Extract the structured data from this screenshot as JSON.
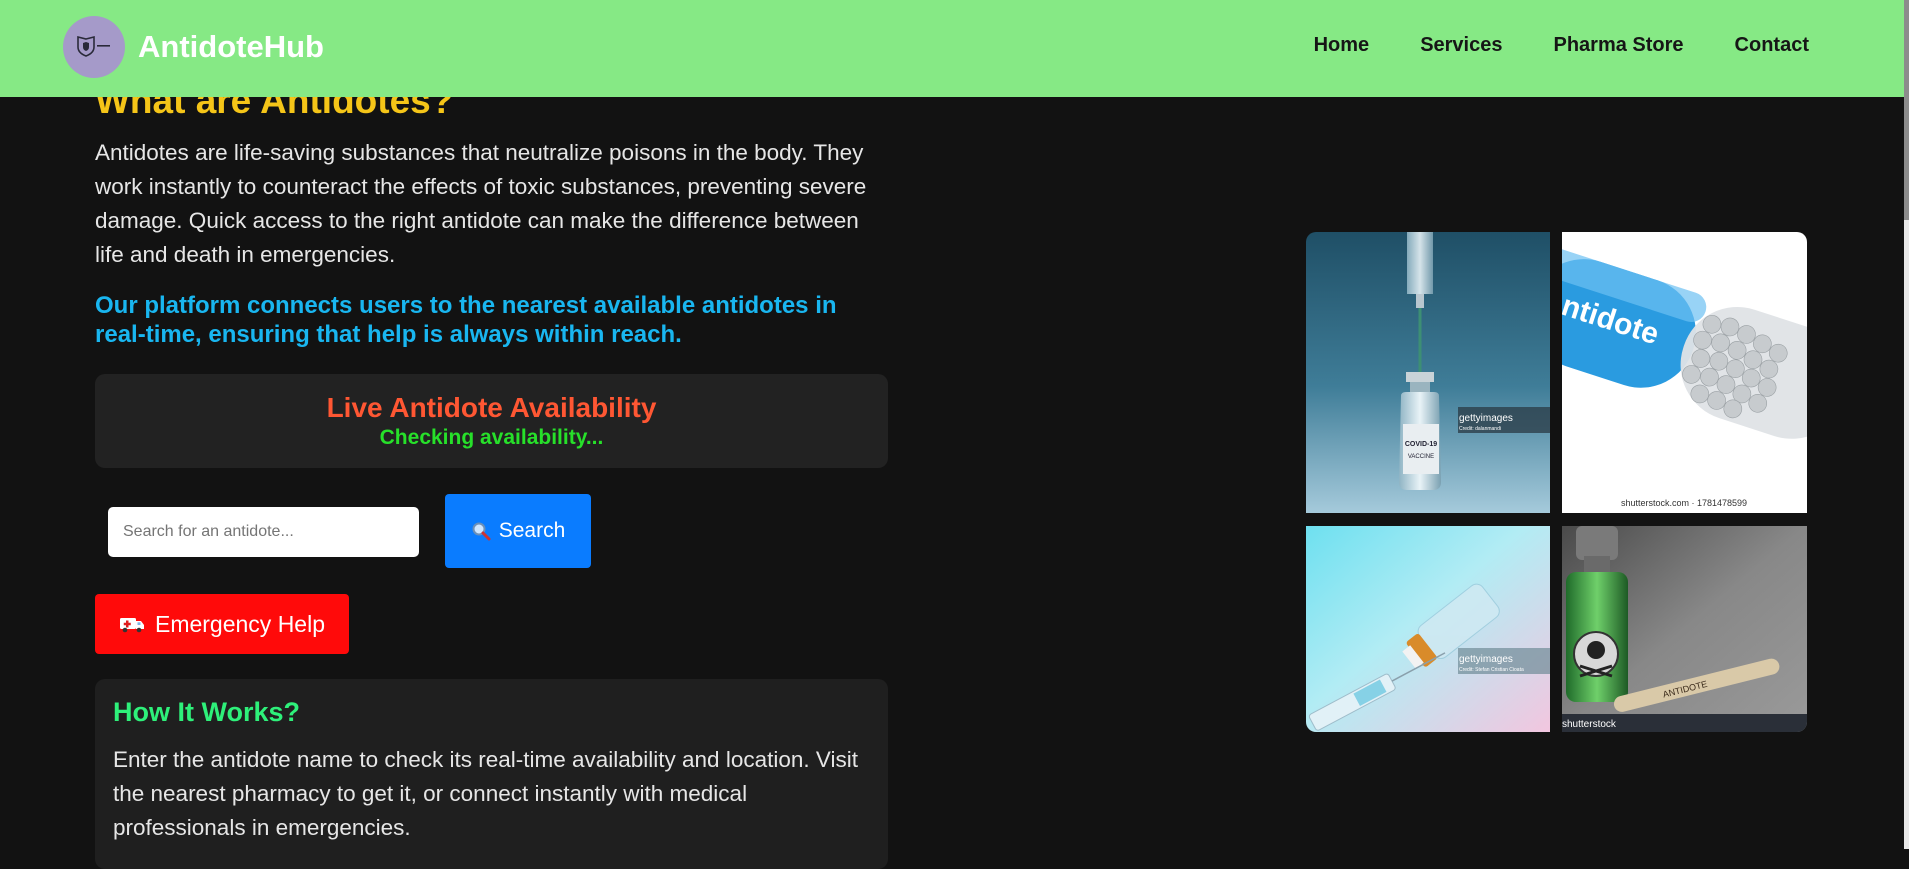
{
  "header": {
    "brand": "AntidoteHub",
    "logo_icon": "shield-logo-icon",
    "nav": [
      {
        "label": "Home"
      },
      {
        "label": "Services"
      },
      {
        "label": "Pharma Store"
      },
      {
        "label": "Contact"
      }
    ]
  },
  "main": {
    "title": "What are Antidotes?",
    "intro": "Antidotes are life-saving substances that neutralize poisons in the body. They work instantly to counteract the effects of toxic substances, preventing severe damage. Quick access to the right antidote can make the difference between life and death in emergencies.",
    "highlight": "Our platform connects users to the nearest available antidotes in real-time, ensuring that help is always within reach.",
    "availability": {
      "title": "Live Antidote Availability",
      "status": "Checking availability..."
    },
    "search": {
      "placeholder": "Search for an antidote...",
      "value": "",
      "button_icon": "magnifier-icon",
      "button_label": "Search"
    },
    "emergency": {
      "icon": "ambulance-icon",
      "label": "Emergency Help"
    },
    "how_it_works": {
      "title": "How It Works?",
      "text": "Enter the antidote name to check its real-time availability and location. Visit the nearest pharmacy to get it, or connect instantly with medical professionals in emergencies."
    }
  },
  "gallery": [
    {
      "name": "vaccine-vial-syringe-image",
      "vial_label_top": "COVID-19",
      "vial_label_bottom": "VACCINE",
      "watermark": "gettyimages",
      "credit": "Credit: dalanmandi"
    },
    {
      "name": "antidote-capsule-image",
      "capsule_text": "ntidote",
      "watermark": "shutterstock.com · 1781478599"
    },
    {
      "name": "syringe-vial-pastel-image",
      "watermark": "gettyimages",
      "credit": "Credit: Stefan Cristian Cioata"
    },
    {
      "name": "poison-bottle-image",
      "label_text": "ANTIDOTE",
      "watermark": "shutterstock"
    }
  ],
  "colors": {
    "navbar": "#86e985",
    "background": "#121212",
    "title": "#f5c518",
    "highlight": "#19b6f0",
    "availability_title": "#ff5733",
    "availability_status": "#27e02a",
    "search_button": "#0a7cff",
    "emergency_button": "#ff0a0a",
    "how_title": "#2ef07a"
  }
}
